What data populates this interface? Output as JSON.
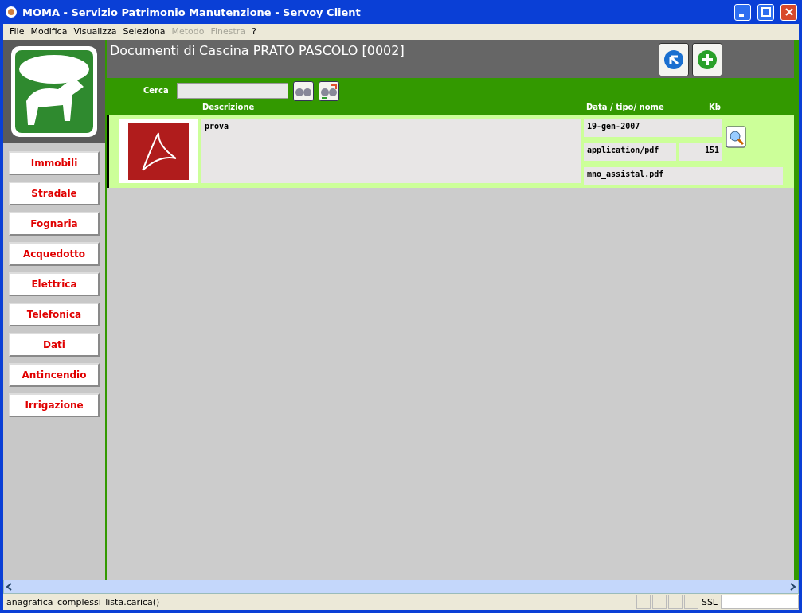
{
  "window": {
    "title": "MOMA - Servizio Patrimonio Manutenzione - Servoy Client"
  },
  "menu": [
    {
      "label": "File",
      "disabled": false
    },
    {
      "label": "Modifica",
      "disabled": false
    },
    {
      "label": "Visualizza",
      "disabled": false
    },
    {
      "label": "Seleziona",
      "disabled": false
    },
    {
      "label": "Metodo",
      "disabled": true
    },
    {
      "label": "Finestra",
      "disabled": true
    },
    {
      "label": "?",
      "disabled": false
    }
  ],
  "sidebar": {
    "items": [
      "Immobili",
      "Stradale",
      "Fognaria",
      "Acquedotto",
      "Elettrica",
      "Telefonica",
      "Dati",
      "Antincendio",
      "Irrigazione"
    ]
  },
  "header": {
    "title": "Documenti di Cascina PRATO PASCOLO [0002]"
  },
  "search": {
    "label": "Cerca"
  },
  "table": {
    "columns": [
      "Descrizione",
      "Data / tipo/ nome",
      "Kb"
    ],
    "rows": [
      {
        "description": "prova",
        "date": "19-gen-2007",
        "type": "application/pdf",
        "kb": "151",
        "filename": "mno_assistal.pdf"
      }
    ]
  },
  "status_bar": {
    "text": "anagrafica_complessi_lista.carica()",
    "ssl": "SSL"
  }
}
